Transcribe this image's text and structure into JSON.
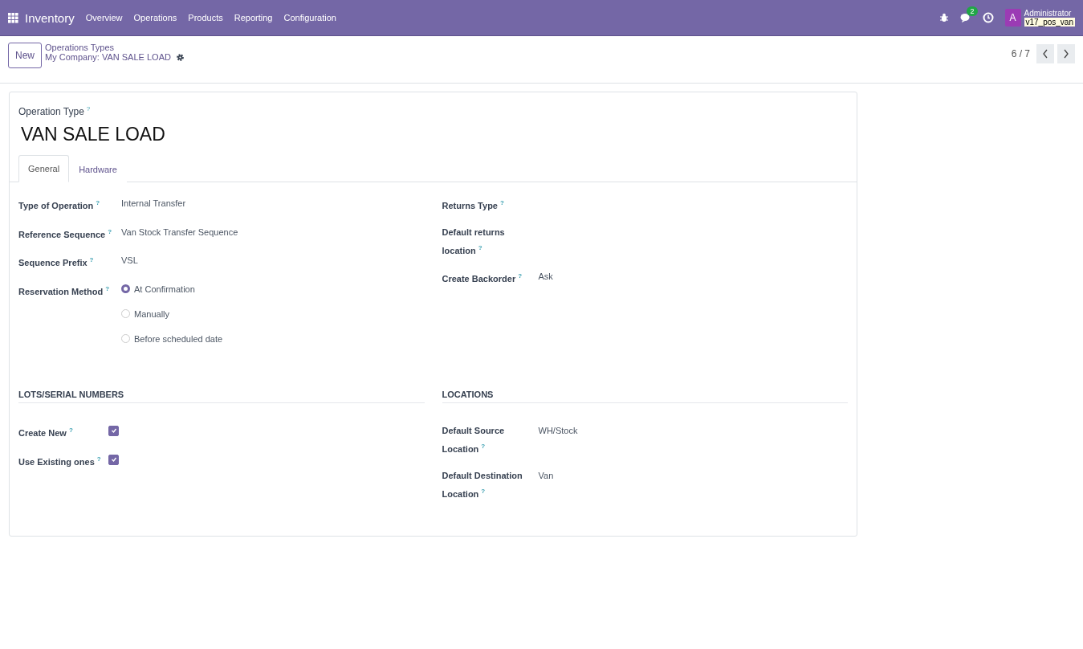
{
  "navbar": {
    "app": "Inventory",
    "menu": [
      "Overview",
      "Operations",
      "Products",
      "Reporting",
      "Configuration"
    ],
    "chat_count": "2",
    "avatar": "A",
    "user": "Administrator",
    "database": "v17_pos_van"
  },
  "control_panel": {
    "new_button": "New",
    "breadcrumb": "Operations Types",
    "record": "My Company: VAN SALE LOAD",
    "pager": "6 / 7"
  },
  "form": {
    "title_label": "Operation Type",
    "title_help": "?",
    "title": "VAN SALE LOAD",
    "tabs": [
      {
        "label": "General",
        "selected": true
      },
      {
        "label": "Hardware",
        "selected": false
      }
    ],
    "left_fields": [
      {
        "kind": "text",
        "label": "Type of Operation",
        "help": "?",
        "value": "Internal Transfer"
      },
      {
        "kind": "text",
        "label": "Reference Sequence",
        "help": "?",
        "value": "Van Stock Transfer Sequence"
      },
      {
        "kind": "text",
        "label": "Sequence Prefix",
        "help": "?",
        "value": "VSL"
      },
      {
        "kind": "radio",
        "label": "Reservation Method",
        "help": "?",
        "options": [
          {
            "label": "At Confirmation",
            "selected": true
          },
          {
            "label": "Manually",
            "selected": false
          },
          {
            "label": "Before scheduled date",
            "selected": false
          }
        ]
      }
    ],
    "right_fields": [
      {
        "kind": "text",
        "label": "Returns Type",
        "help": "?"
      },
      {
        "kind": "text",
        "label": "Default returns location",
        "help": "?"
      },
      {
        "kind": "text",
        "label": "Create Backorder",
        "help": "?",
        "value": "Ask"
      }
    ],
    "sections": [
      {
        "title": "LOTS/SERIAL NUMBERS",
        "fields": [
          {
            "kind": "checkbox",
            "label": "Create New",
            "help": "?",
            "checked": true
          },
          {
            "kind": "checkbox",
            "label": "Use Existing ones",
            "help": "?",
            "checked": true
          }
        ]
      },
      {
        "title": "LOCATIONS",
        "fields": [
          {
            "kind": "text",
            "label": "Default Source Location",
            "help": "?",
            "value": "WH/Stock"
          },
          {
            "kind": "text",
            "label": "Default Destination Location",
            "help": "?",
            "value": "Van"
          }
        ]
      }
    ]
  }
}
